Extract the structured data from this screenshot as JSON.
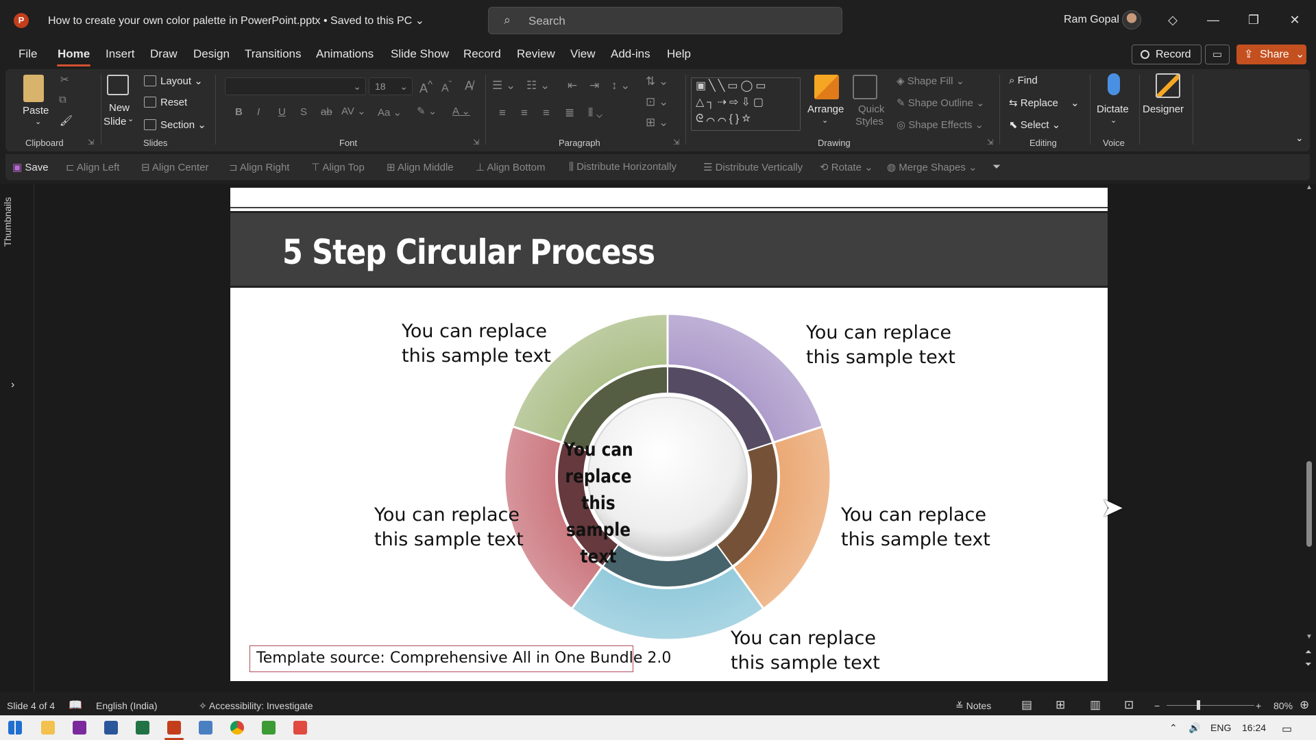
{
  "titlebar": {
    "app_letter": "P",
    "doc_title": "How to create your own color palette in PowerPoint.pptx • Saved to this PC",
    "search_placeholder": "Search",
    "user_name": "Ram Gopal"
  },
  "menu": {
    "items": [
      "File",
      "Home",
      "Insert",
      "Draw",
      "Design",
      "Transitions",
      "Animations",
      "Slide Show",
      "Record",
      "Review",
      "View",
      "Add-ins",
      "Help"
    ],
    "record_label": "Record",
    "share_label": "Share"
  },
  "ribbon": {
    "clipboard": {
      "label": "Clipboard",
      "paste": "Paste"
    },
    "slides": {
      "label": "Slides",
      "new_slide_1": "New",
      "new_slide_2": "Slide",
      "layout": "Layout",
      "reset": "Reset",
      "section": "Section"
    },
    "font": {
      "label": "Font",
      "size": "18"
    },
    "paragraph": {
      "label": "Paragraph"
    },
    "drawing": {
      "label": "Drawing",
      "arrange": "Arrange",
      "quick_styles_1": "Quick",
      "quick_styles_2": "Styles",
      "shape_fill": "Shape Fill",
      "shape_outline": "Shape Outline",
      "shape_effects": "Shape Effects"
    },
    "editing": {
      "label": "Editing",
      "find": "Find",
      "replace": "Replace",
      "select": "Select"
    },
    "voice": {
      "label": "Voice",
      "dictate": "Dictate"
    },
    "designer": {
      "label": "Designer"
    }
  },
  "qat": {
    "save": "Save",
    "items": [
      "Align Left",
      "Align Center",
      "Align Right",
      "Align Top",
      "Align Middle",
      "Align Bottom",
      "Distribute Horizontally",
      "Distribute Vertically",
      "Rotate",
      "Merge Shapes"
    ]
  },
  "sidebar": {
    "thumbnails": "Thumbnails"
  },
  "slide": {
    "title": "5 Step Circular Process",
    "sample_line1": "You can replace",
    "sample_line2": "this sample text",
    "center_text": "You can replace this sample text",
    "source": "Template source: Comprehensive All in One Bundle 2.0",
    "segment_colors": [
      "#a9bc83",
      "#a997c8",
      "#eaa46d",
      "#8ec8da",
      "#c9727a"
    ]
  },
  "status": {
    "slide_info": "Slide 4 of 4",
    "language": "English (India)",
    "accessibility": "Accessibility: Investigate",
    "notes": "Notes",
    "zoom": "80%"
  },
  "taskbar": {
    "lang": "ENG",
    "time": "16:24"
  }
}
